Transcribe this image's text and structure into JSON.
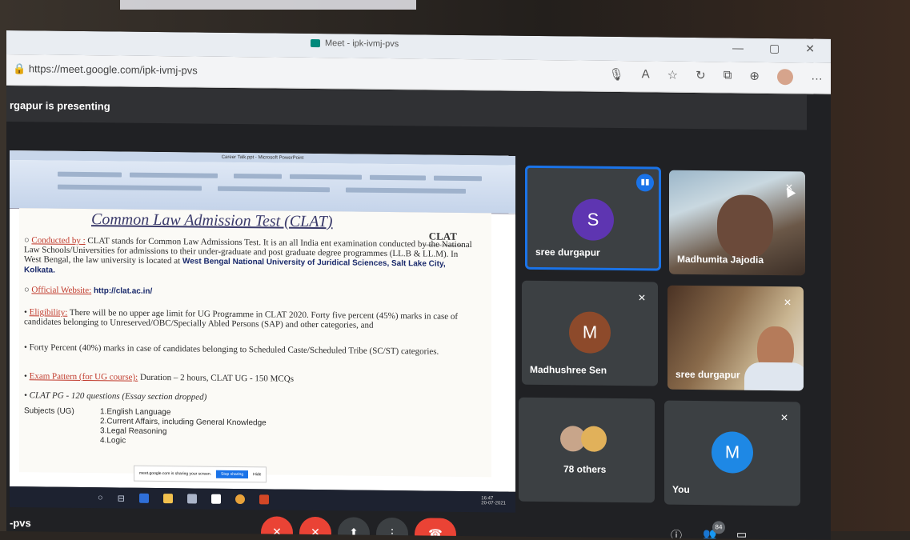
{
  "browser": {
    "tab_title": "Meet - ipk-ivmj-pvs",
    "url": "https://meet.google.com/ipk-ivmj-pvs",
    "window_controls": [
      "—",
      "▢",
      "✕"
    ]
  },
  "banner": {
    "presenting_text": "rgapur is presenting"
  },
  "ppt": {
    "window_title": "Career Talk.ppt - Microsoft PowerPoint"
  },
  "slide": {
    "title": "Common Law Admission Test (CLAT)",
    "logo": "CLAT",
    "logo_sub": "Common Law Admission Test",
    "conducted_label": "Conducted by :",
    "conducted_text": " CLAT stands for Common Law Admissions Test. It is an all India ent examination conducted by the National Law Schools/Universities for admissions to their under-graduate and post graduate degree programmes (LL.B & LL.M). In West Bengal, the law university is located at ",
    "conducted_bold": "West Bengal National University of Juridical Sciences, Salt Lake City, Kolkata.",
    "website_label": "Official Website:",
    "website_url": "http://clat.ac.in/",
    "eligibility_label": "Eligibility:",
    "eligibility_text": " There will be no upper age limit for UG Programme in CLAT 2020. Forty five percent (45%) marks in case of candidates belonging to Unreserved/OBC/Specially Abled Persons (SAP) and other categories, and",
    "forty_text": "Forty Percent (40%) marks in case of candidates belonging to Scheduled Caste/Scheduled Tribe (SC/ST) categories.",
    "exam_label": "Exam Pattern (for UG course):",
    "exam_text": " Duration – 2 hours, CLAT UG - 150 MCQs",
    "pg_text": "CLAT PG - 120 questions (Essay section dropped)",
    "subjects_label": "Subjects (UG)",
    "subjects": [
      "1.English Language",
      "2.Current Affairs, including General Knowledge",
      "3.Legal Reasoning",
      "4.Logic"
    ]
  },
  "share_pill": {
    "text": "meet.google.com is sharing your screen.",
    "stop_label": "Stop sharing",
    "hide_label": "Hide"
  },
  "taskbar": {
    "time": "16:47",
    "date": "20-07-2021"
  },
  "participants": [
    {
      "name": "sree durgapur",
      "initial": "S",
      "color": "#5e35b1"
    },
    {
      "name": "Madhumita Jajodia"
    },
    {
      "name": "Madhushree Sen",
      "initial": "M",
      "color": "#8d4a2b"
    },
    {
      "name": "sree durgapur"
    },
    {
      "name": "78 others"
    },
    {
      "name": "You",
      "initial": "M",
      "color": "#1e88e5"
    }
  ],
  "controls": {
    "meeting_code": "-pvs",
    "people_count": "84"
  }
}
